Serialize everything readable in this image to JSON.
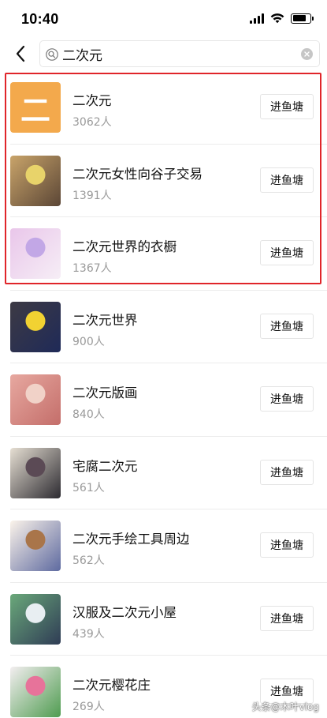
{
  "status_bar": {
    "time": "10:40",
    "icons": [
      "signal-icon",
      "wifi-icon",
      "battery-icon"
    ]
  },
  "search": {
    "back_icon": "chevron-left-icon",
    "search_icon": "search-icon",
    "query": "二次元",
    "clear_icon": "clear-icon"
  },
  "results": [
    {
      "name": "二次元",
      "members": "3062人",
      "join_label": "进鱼塘",
      "thumb": {
        "kind": "text",
        "text": "二",
        "colors": [
          "#f3a94c"
        ]
      }
    },
    {
      "name": "二次元女性向谷子交易",
      "members": "1391人",
      "join_label": "进鱼塘",
      "thumb": {
        "kind": "photo",
        "colors": [
          "#c9a46a",
          "#e8d36a",
          "#5b4636"
        ]
      }
    },
    {
      "name": "二次元世界的衣橱",
      "members": "1367人",
      "join_label": "进鱼塘",
      "thumb": {
        "kind": "photo",
        "colors": [
          "#e9c6ea",
          "#c2a7e6",
          "#f6eef6"
        ]
      }
    },
    {
      "name": "二次元世界",
      "members": "900人",
      "join_label": "进鱼塘",
      "thumb": {
        "kind": "photo",
        "colors": [
          "#3d3a44",
          "#f2d232",
          "#1f2a58"
        ]
      }
    },
    {
      "name": "二次元版画",
      "members": "840人",
      "join_label": "进鱼塘",
      "thumb": {
        "kind": "photo",
        "colors": [
          "#e7a8a0",
          "#f1d2c8",
          "#c46e6a"
        ]
      }
    },
    {
      "name": "宅腐二次元",
      "members": "561人",
      "join_label": "进鱼塘",
      "thumb": {
        "kind": "photo",
        "colors": [
          "#e6dfd3",
          "#5b4a55",
          "#2c2a30"
        ]
      }
    },
    {
      "name": "二次元手绘工具周边",
      "members": "562人",
      "join_label": "进鱼塘",
      "thumb": {
        "kind": "photo",
        "colors": [
          "#fbf3ea",
          "#a9754a",
          "#5e6aa0"
        ]
      }
    },
    {
      "name": "汉服及二次元小屋",
      "members": "439人",
      "join_label": "进鱼塘",
      "thumb": {
        "kind": "photo",
        "colors": [
          "#6aa87a",
          "#e8eef2",
          "#2f3c55"
        ]
      }
    },
    {
      "name": "二次元樱花庄",
      "members": "269人",
      "join_label": "进鱼塘",
      "thumb": {
        "kind": "photo",
        "colors": [
          "#f3eef0",
          "#e7739a",
          "#4f9c50"
        ]
      }
    }
  ],
  "highlight": {
    "color": "#e0252a",
    "covers": [
      "二次元",
      "二次元女性向谷子交易",
      "二次元世界的衣橱"
    ]
  },
  "watermark": "头条@木叶vlog",
  "colors": {
    "accent": "#e0252a",
    "secondary_text": "#9a9a9a",
    "divider": "#ececec"
  }
}
